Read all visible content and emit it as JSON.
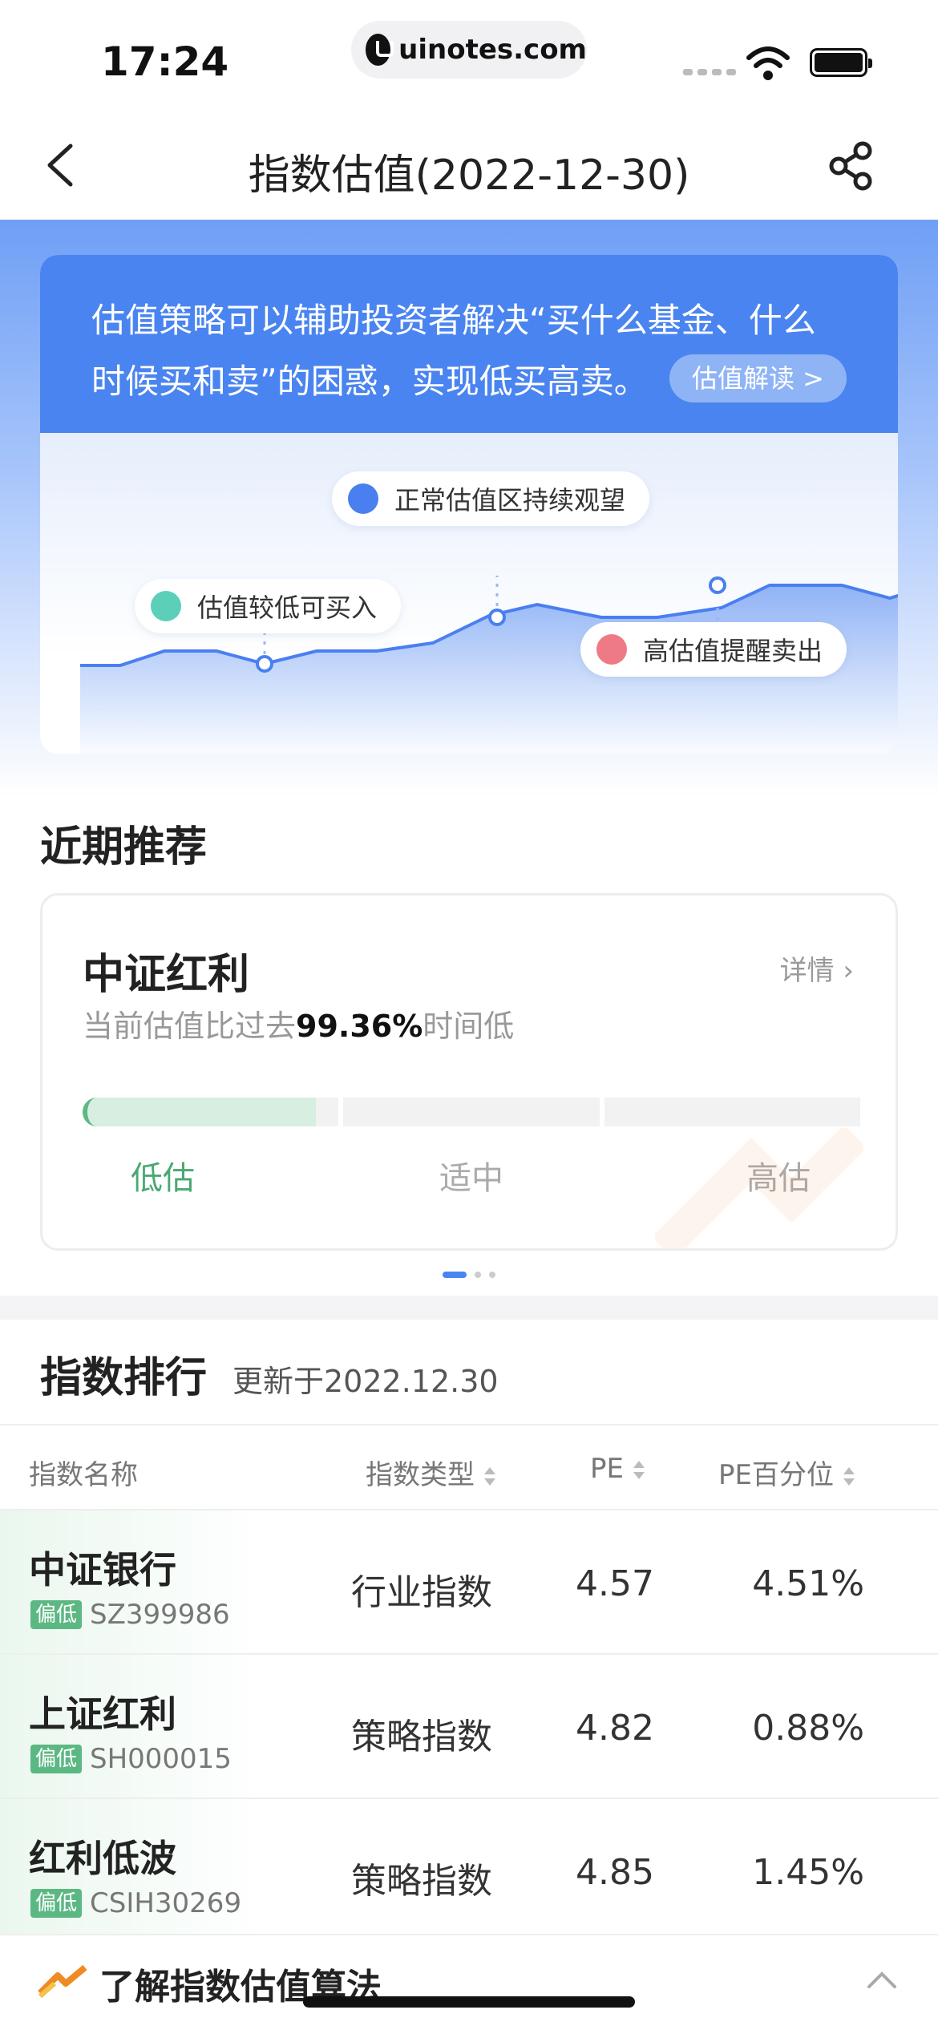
{
  "status_bar": {
    "time": "17:24",
    "url": "uinotes.com"
  },
  "nav": {
    "title": "指数估值(2022-12-30)"
  },
  "hero": {
    "intro_line1": "估值策略可以辅助投资者解决“买什么基金、什么",
    "intro_line2": "时候买和卖”的困惑，实现低买高卖。",
    "button": "估值解读 >",
    "bubbles": {
      "low": "估值较低可买入",
      "normal": "正常估值区持续观望",
      "high": "高估值提醒卖出"
    },
    "colors": {
      "low": "#5ccfb8",
      "normal": "#4a7ff0",
      "high": "#ee7a86"
    }
  },
  "recommend": {
    "section_title": "近期推荐",
    "name": "中证红利",
    "detail": "详情 ›",
    "desc_prefix": "当前估值比过去",
    "desc_value": "99.36%",
    "desc_suffix": "时间低",
    "labels": {
      "low": "低估",
      "mid": "适中",
      "high": "高估"
    },
    "level_fraction": 0.3
  },
  "ranking": {
    "title": "指数排行",
    "updated": "更新于2022.12.30",
    "columns": {
      "name": "指数名称",
      "type": "指数类型",
      "pe": "PE",
      "pct": "PE百分位"
    },
    "rows": [
      {
        "name": "中证银行",
        "tag": "偏低",
        "code": "SZ399986",
        "type": "行业指数",
        "pe": "4.57",
        "pct": "4.51%"
      },
      {
        "name": "上证红利",
        "tag": "偏低",
        "code": "SH000015",
        "type": "策略指数",
        "pe": "4.82",
        "pct": "0.88%"
      },
      {
        "name": "红利低波",
        "tag": "偏低",
        "code": "CSIH30269",
        "type": "策略指数",
        "pe": "4.85",
        "pct": "1.45%"
      }
    ]
  },
  "bottom_bar": {
    "text": "了解指数估值算法"
  }
}
